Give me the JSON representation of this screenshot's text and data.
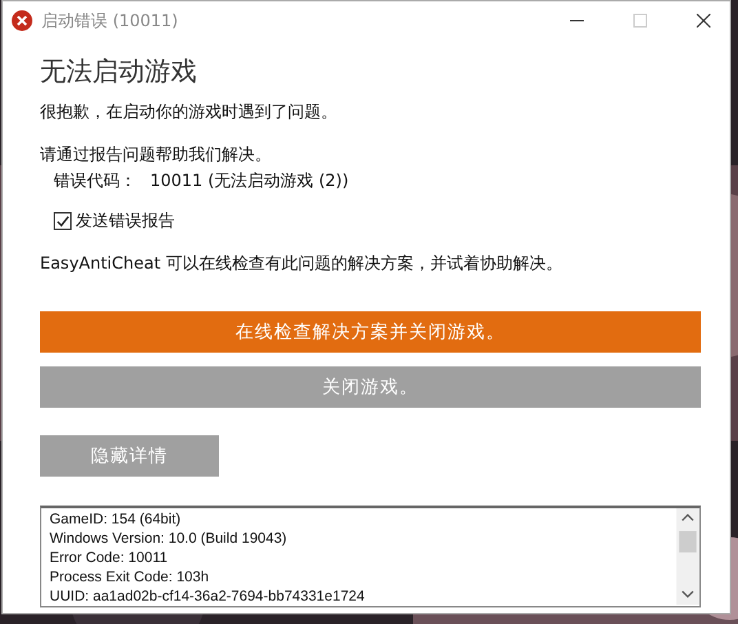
{
  "window": {
    "title": "启动错误 (10011)"
  },
  "heading": "无法启动游戏",
  "message": "很抱歉，在启动你的游戏时遇到了问题。",
  "help": "请通过报告问题帮助我们解决。",
  "error_code": {
    "label": "错误代码：",
    "value": "10011 (无法启动游戏 (2))"
  },
  "send_report": {
    "label": "发送错误报告",
    "checked": true
  },
  "info": "EasyAntiCheat 可以在线检查有此问题的解决方案，并试着协助解决。",
  "buttons": [
    {
      "label": "在线检查解决方案并关闭游戏。",
      "kind": "primary"
    },
    {
      "label": "关闭游戏。",
      "kind": "secondary"
    },
    {
      "label": "隐藏详情",
      "kind": "small"
    }
  ],
  "details": [
    "GameID: 154 (64bit)",
    "Windows Version: 10.0 (Build 19043)",
    "Error Code: 10011",
    "Process Exit Code: 103h",
    "UUID: aa1ad02b-cf14-36a2-7694-bb74331e1724"
  ]
}
